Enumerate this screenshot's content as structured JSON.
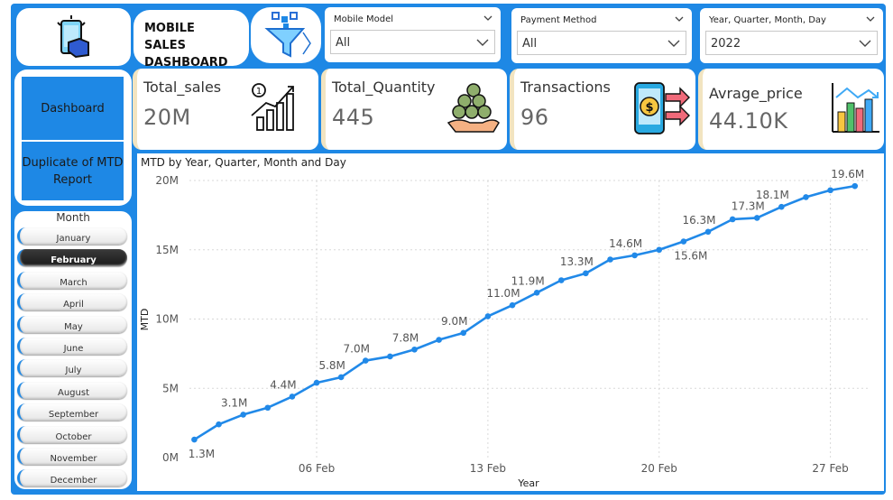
{
  "header": {
    "title": "MOBILE SALES DASHBOARD"
  },
  "filters": [
    {
      "label": "Mobile Model",
      "value": "All"
    },
    {
      "label": "Payment Method",
      "value": "All"
    },
    {
      "label": "Year, Quarter, Month, Day",
      "value": "2022"
    }
  ],
  "kpis": [
    {
      "label": "Total_sales",
      "value": "20M",
      "icon": "growth-chart-icon"
    },
    {
      "label": "Total_Quantity",
      "value": "445",
      "icon": "coins-hand-icon"
    },
    {
      "label": "Transactions",
      "value": "96",
      "icon": "phone-payment-icon"
    },
    {
      "label": "Avrage_price",
      "value": "44.10K",
      "icon": "bar-chart-icon"
    }
  ],
  "nav": {
    "dashboard": "Dashboard",
    "mtd_report": "Duplicate of MTD Report"
  },
  "month_slicer": {
    "title": "Month",
    "months": [
      "January",
      "February",
      "March",
      "April",
      "May",
      "June",
      "July",
      "August",
      "September",
      "October",
      "November",
      "December"
    ],
    "selected": "February"
  },
  "colors": {
    "accent": "#1e88e5",
    "line": "#2189e8",
    "kpi_border": "#f2e4c0"
  },
  "chart_data": {
    "type": "line",
    "title": "MTD by Year, Quarter, Month and Day",
    "xlabel": "Year",
    "ylabel": "MTD",
    "ylim": [
      0,
      20
    ],
    "yticks": [
      "0M",
      "5M",
      "10M",
      "15M",
      "20M"
    ],
    "xticks": [
      {
        "day": 6,
        "label": "06 Feb"
      },
      {
        "day": 13,
        "label": "13 Feb"
      },
      {
        "day": 20,
        "label": "20 Feb"
      },
      {
        "day": 27,
        "label": "27 Feb"
      }
    ],
    "grid": true,
    "series": [
      {
        "x": [
          1,
          2,
          3,
          4,
          5,
          6,
          7,
          8,
          9,
          10,
          11,
          12,
          13,
          14,
          15,
          16,
          17,
          18,
          19,
          20,
          21,
          22,
          23,
          24,
          25,
          26,
          27,
          28
        ],
        "values": [
          1.3,
          2.4,
          3.1,
          3.6,
          4.4,
          5.4,
          5.8,
          7.0,
          7.3,
          7.8,
          8.5,
          9.0,
          10.2,
          11.0,
          11.9,
          12.8,
          13.3,
          14.3,
          14.6,
          15.0,
          15.6,
          16.3,
          17.2,
          17.3,
          18.1,
          18.8,
          19.3,
          19.6
        ]
      }
    ],
    "data_labels": [
      {
        "i": 0,
        "text": "1.3M"
      },
      {
        "i": 2,
        "text": "3.1M"
      },
      {
        "i": 4,
        "text": "4.4M"
      },
      {
        "i": 6,
        "text": "5.8M"
      },
      {
        "i": 7,
        "text": "7.0M"
      },
      {
        "i": 9,
        "text": "7.8M"
      },
      {
        "i": 11,
        "text": "9.0M"
      },
      {
        "i": 13,
        "text": "11.0M"
      },
      {
        "i": 14,
        "text": "11.9M"
      },
      {
        "i": 16,
        "text": "13.3M"
      },
      {
        "i": 18,
        "text": "14.6M"
      },
      {
        "i": 20,
        "text": "15.6M"
      },
      {
        "i": 21,
        "text": "16.3M"
      },
      {
        "i": 23,
        "text": "17.3M"
      },
      {
        "i": 24,
        "text": "18.1M"
      },
      {
        "i": 27,
        "text": "19.6M"
      }
    ]
  }
}
